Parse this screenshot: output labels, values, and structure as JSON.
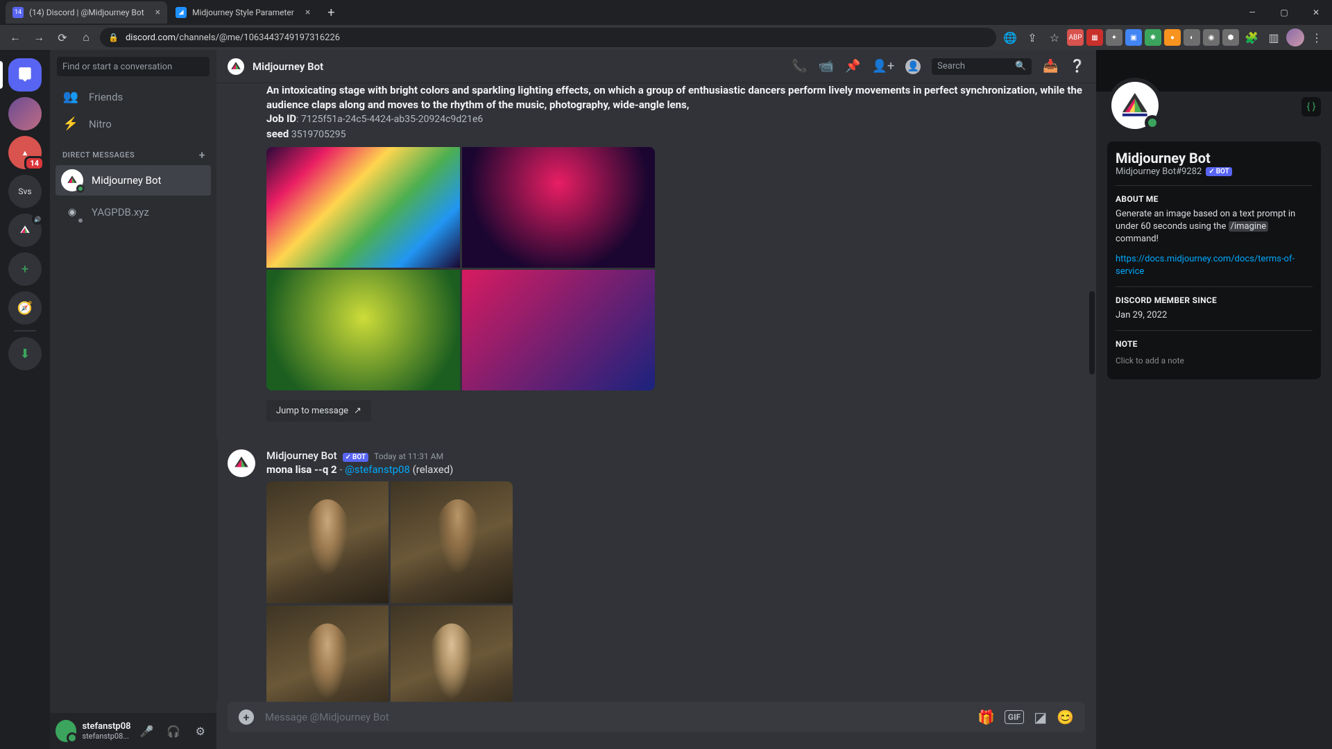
{
  "browser": {
    "tabs": [
      {
        "title": "(14) Discord | @Midjourney Bot",
        "active": true
      },
      {
        "title": "Midjourney Style Parameter",
        "active": false
      }
    ],
    "url_domain": "discord.com",
    "url_path": "/channels/@me/1063443749197316226"
  },
  "servers": {
    "badge_14": "14",
    "svs": "Svs"
  },
  "sidebar": {
    "search_placeholder": "Find or start a conversation",
    "friends": "Friends",
    "nitro": "Nitro",
    "dm_header": "DIRECT MESSAGES",
    "dms": [
      {
        "name": "Midjourney Bot",
        "active": true
      },
      {
        "name": "YAGPDB.xyz",
        "active": false
      }
    ]
  },
  "user_panel": {
    "name": "stefanstp08",
    "tag": "stefanstp08..."
  },
  "header": {
    "title": "Midjourney Bot",
    "search_placeholder": "Search"
  },
  "messages": {
    "prompt_fragment": "An intoxicating stage with bright colors and sparkling lighting effects, on which a group of enthusiastic dancers perform lively movements in perfect synchronization, while the audience claps along and moves to the rhythm of the music, photography, wide-angle lens,",
    "job_id_label": "Job ID",
    "job_id": ": 7125f51a-24c5-4424-ab35-20924c9d21e6",
    "seed_label": "seed",
    "seed": " 3519705295",
    "jump": "Jump to message",
    "msg2": {
      "author": "Midjourney Bot",
      "bot": "BOT",
      "time": "Today at 11:31 AM",
      "prompt_bold": "mona lisa --q 2",
      "dash": " - ",
      "mention": "@stefanstp08",
      "relaxed": " (relaxed)"
    }
  },
  "input": {
    "placeholder": "Message @Midjourney Bot",
    "gif": "GIF"
  },
  "profile": {
    "name": "Midjourney Bot",
    "tag": "Midjourney Bot#9282",
    "bot": "BOT",
    "about_label": "ABOUT ME",
    "about_text": "Generate an image based on a text prompt in under 60 seconds using the ",
    "imagine": "/imagine",
    "about_text2": " command!",
    "link": "https://docs.midjourney.com/docs/terms-of-service",
    "member_label": "DISCORD MEMBER SINCE",
    "member_date": "Jan 29, 2022",
    "note_label": "NOTE",
    "note_placeholder": "Click to add a note"
  }
}
